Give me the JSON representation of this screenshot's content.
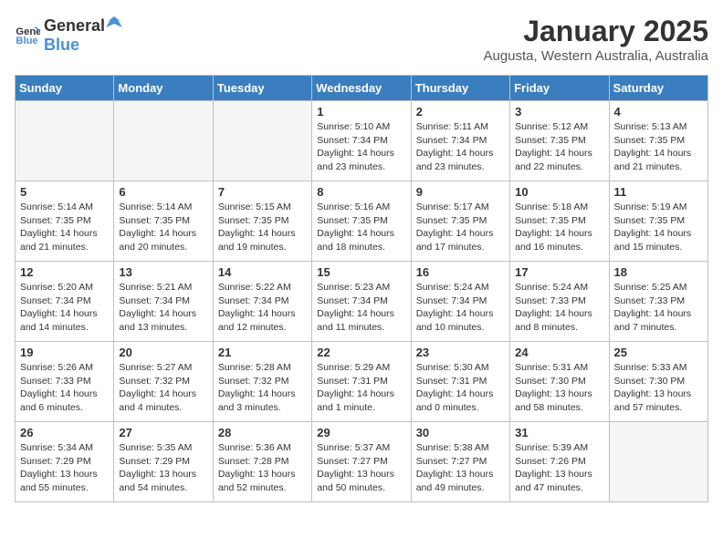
{
  "header": {
    "logo_general": "General",
    "logo_blue": "Blue",
    "month_title": "January 2025",
    "location": "Augusta, Western Australia, Australia"
  },
  "days_of_week": [
    "Sunday",
    "Monday",
    "Tuesday",
    "Wednesday",
    "Thursday",
    "Friday",
    "Saturday"
  ],
  "weeks": [
    [
      {
        "day": "",
        "info": ""
      },
      {
        "day": "",
        "info": ""
      },
      {
        "day": "",
        "info": ""
      },
      {
        "day": "1",
        "info": "Sunrise: 5:10 AM\nSunset: 7:34 PM\nDaylight: 14 hours\nand 23 minutes."
      },
      {
        "day": "2",
        "info": "Sunrise: 5:11 AM\nSunset: 7:34 PM\nDaylight: 14 hours\nand 23 minutes."
      },
      {
        "day": "3",
        "info": "Sunrise: 5:12 AM\nSunset: 7:35 PM\nDaylight: 14 hours\nand 22 minutes."
      },
      {
        "day": "4",
        "info": "Sunrise: 5:13 AM\nSunset: 7:35 PM\nDaylight: 14 hours\nand 21 minutes."
      }
    ],
    [
      {
        "day": "5",
        "info": "Sunrise: 5:14 AM\nSunset: 7:35 PM\nDaylight: 14 hours\nand 21 minutes."
      },
      {
        "day": "6",
        "info": "Sunrise: 5:14 AM\nSunset: 7:35 PM\nDaylight: 14 hours\nand 20 minutes."
      },
      {
        "day": "7",
        "info": "Sunrise: 5:15 AM\nSunset: 7:35 PM\nDaylight: 14 hours\nand 19 minutes."
      },
      {
        "day": "8",
        "info": "Sunrise: 5:16 AM\nSunset: 7:35 PM\nDaylight: 14 hours\nand 18 minutes."
      },
      {
        "day": "9",
        "info": "Sunrise: 5:17 AM\nSunset: 7:35 PM\nDaylight: 14 hours\nand 17 minutes."
      },
      {
        "day": "10",
        "info": "Sunrise: 5:18 AM\nSunset: 7:35 PM\nDaylight: 14 hours\nand 16 minutes."
      },
      {
        "day": "11",
        "info": "Sunrise: 5:19 AM\nSunset: 7:35 PM\nDaylight: 14 hours\nand 15 minutes."
      }
    ],
    [
      {
        "day": "12",
        "info": "Sunrise: 5:20 AM\nSunset: 7:34 PM\nDaylight: 14 hours\nand 14 minutes."
      },
      {
        "day": "13",
        "info": "Sunrise: 5:21 AM\nSunset: 7:34 PM\nDaylight: 14 hours\nand 13 minutes."
      },
      {
        "day": "14",
        "info": "Sunrise: 5:22 AM\nSunset: 7:34 PM\nDaylight: 14 hours\nand 12 minutes."
      },
      {
        "day": "15",
        "info": "Sunrise: 5:23 AM\nSunset: 7:34 PM\nDaylight: 14 hours\nand 11 minutes."
      },
      {
        "day": "16",
        "info": "Sunrise: 5:24 AM\nSunset: 7:34 PM\nDaylight: 14 hours\nand 10 minutes."
      },
      {
        "day": "17",
        "info": "Sunrise: 5:24 AM\nSunset: 7:33 PM\nDaylight: 14 hours\nand 8 minutes."
      },
      {
        "day": "18",
        "info": "Sunrise: 5:25 AM\nSunset: 7:33 PM\nDaylight: 14 hours\nand 7 minutes."
      }
    ],
    [
      {
        "day": "19",
        "info": "Sunrise: 5:26 AM\nSunset: 7:33 PM\nDaylight: 14 hours\nand 6 minutes."
      },
      {
        "day": "20",
        "info": "Sunrise: 5:27 AM\nSunset: 7:32 PM\nDaylight: 14 hours\nand 4 minutes."
      },
      {
        "day": "21",
        "info": "Sunrise: 5:28 AM\nSunset: 7:32 PM\nDaylight: 14 hours\nand 3 minutes."
      },
      {
        "day": "22",
        "info": "Sunrise: 5:29 AM\nSunset: 7:31 PM\nDaylight: 14 hours\nand 1 minute."
      },
      {
        "day": "23",
        "info": "Sunrise: 5:30 AM\nSunset: 7:31 PM\nDaylight: 14 hours\nand 0 minutes."
      },
      {
        "day": "24",
        "info": "Sunrise: 5:31 AM\nSunset: 7:30 PM\nDaylight: 13 hours\nand 58 minutes."
      },
      {
        "day": "25",
        "info": "Sunrise: 5:33 AM\nSunset: 7:30 PM\nDaylight: 13 hours\nand 57 minutes."
      }
    ],
    [
      {
        "day": "26",
        "info": "Sunrise: 5:34 AM\nSunset: 7:29 PM\nDaylight: 13 hours\nand 55 minutes."
      },
      {
        "day": "27",
        "info": "Sunrise: 5:35 AM\nSunset: 7:29 PM\nDaylight: 13 hours\nand 54 minutes."
      },
      {
        "day": "28",
        "info": "Sunrise: 5:36 AM\nSunset: 7:28 PM\nDaylight: 13 hours\nand 52 minutes."
      },
      {
        "day": "29",
        "info": "Sunrise: 5:37 AM\nSunset: 7:27 PM\nDaylight: 13 hours\nand 50 minutes."
      },
      {
        "day": "30",
        "info": "Sunrise: 5:38 AM\nSunset: 7:27 PM\nDaylight: 13 hours\nand 49 minutes."
      },
      {
        "day": "31",
        "info": "Sunrise: 5:39 AM\nSunset: 7:26 PM\nDaylight: 13 hours\nand 47 minutes."
      },
      {
        "day": "",
        "info": ""
      }
    ]
  ]
}
